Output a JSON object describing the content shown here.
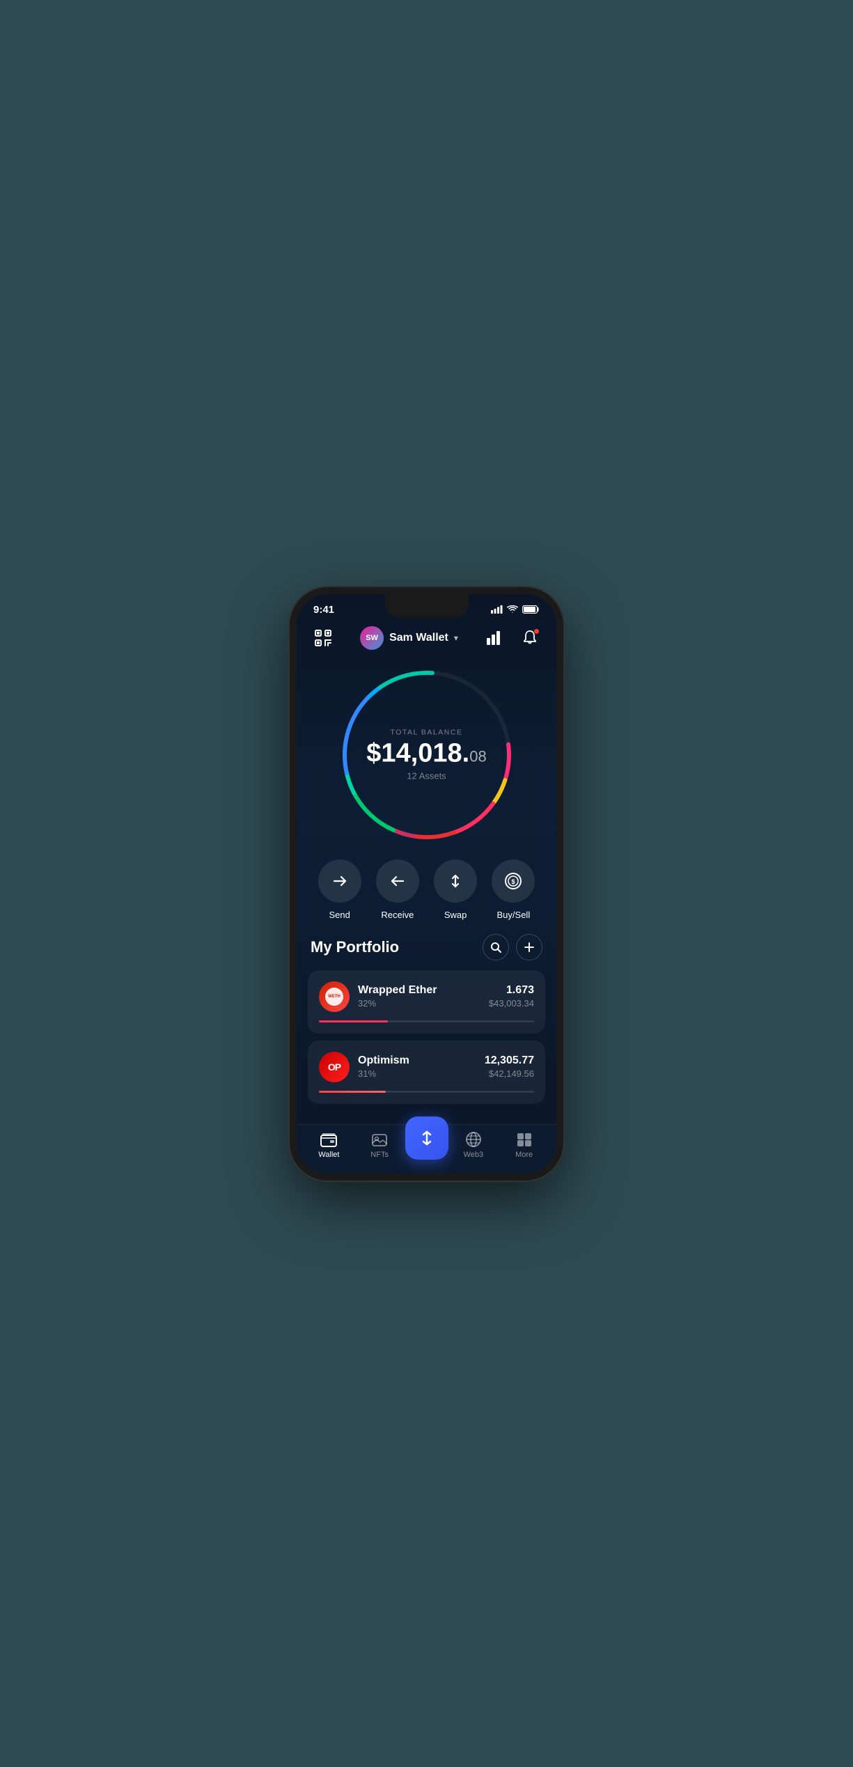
{
  "status": {
    "time": "9:41",
    "signal": "▋▋▋▋",
    "wifi": "wifi",
    "battery": "battery"
  },
  "header": {
    "scan_label": "scan",
    "user_initials": "SW",
    "user_name": "Sam Wallet",
    "chevron": "▾",
    "chart_icon": "chart",
    "notification_icon": "bell"
  },
  "balance": {
    "label": "TOTAL BALANCE",
    "main": "$14,018.",
    "cents": "08",
    "assets_count": "12 Assets"
  },
  "actions": [
    {
      "id": "send",
      "label": "Send",
      "icon": "→"
    },
    {
      "id": "receive",
      "label": "Receive",
      "icon": "←"
    },
    {
      "id": "swap",
      "label": "Swap",
      "icon": "⇅"
    },
    {
      "id": "buysell",
      "label": "Buy/Sell",
      "icon": "$"
    }
  ],
  "portfolio": {
    "title": "My Portfolio",
    "search_label": "search",
    "add_label": "add",
    "assets": [
      {
        "id": "weth",
        "name": "Wrapped Ether",
        "pct": "32%",
        "amount": "1.673",
        "usd": "$43,003.34",
        "bar_pct": 32,
        "logo_text": "WETH"
      },
      {
        "id": "op",
        "name": "Optimism",
        "pct": "31%",
        "amount": "12,305.77",
        "usd": "$42,149.56",
        "bar_pct": 31,
        "logo_text": "OP"
      }
    ]
  },
  "nav": {
    "items": [
      {
        "id": "wallet",
        "label": "Wallet",
        "active": true
      },
      {
        "id": "nfts",
        "label": "NFTs",
        "active": false
      },
      {
        "id": "swap_center",
        "label": "",
        "active": false,
        "center": true
      },
      {
        "id": "web3",
        "label": "Web3",
        "active": false
      },
      {
        "id": "more",
        "label": "More",
        "active": false
      }
    ]
  }
}
